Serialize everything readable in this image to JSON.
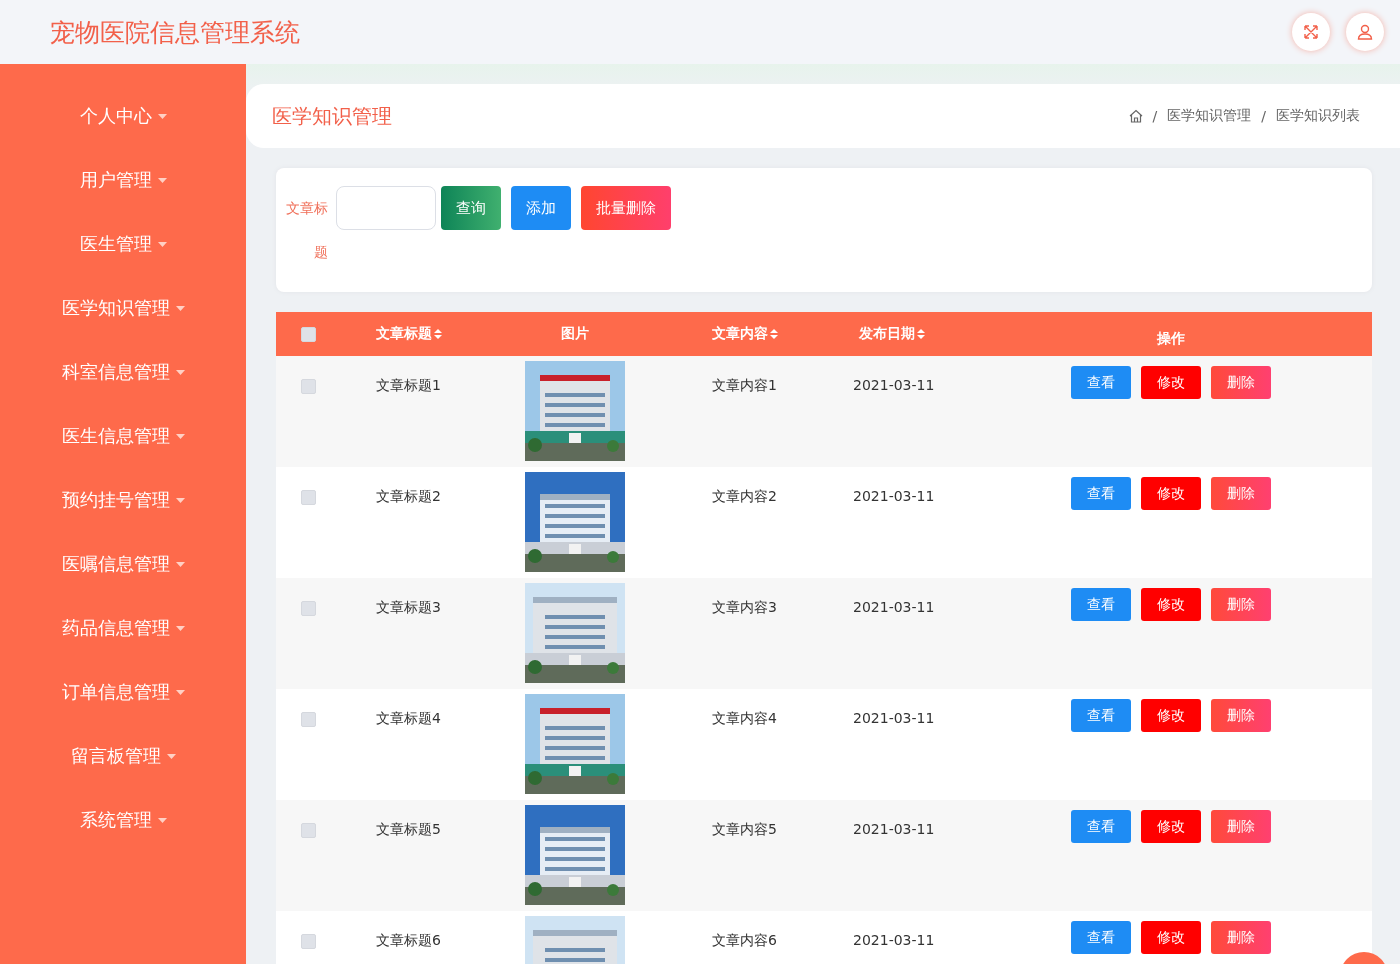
{
  "header": {
    "title": "宠物医院信息管理系统"
  },
  "sidebar": {
    "items": [
      {
        "label": "个人中心"
      },
      {
        "label": "用户管理"
      },
      {
        "label": "医生管理"
      },
      {
        "label": "医学知识管理"
      },
      {
        "label": "科室信息管理"
      },
      {
        "label": "医生信息管理"
      },
      {
        "label": "预约挂号管理"
      },
      {
        "label": "医嘱信息管理"
      },
      {
        "label": "药品信息管理"
      },
      {
        "label": "订单信息管理"
      },
      {
        "label": "留言板管理"
      },
      {
        "label": "系统管理"
      }
    ]
  },
  "page_title": "医学知识管理",
  "breadcrumb": [
    {
      "separator": "/",
      "label": "医学知识管理"
    },
    {
      "separator": "/",
      "label": "医学知识列表"
    }
  ],
  "search": {
    "label": "文章标题",
    "buttons": [
      {
        "label": "查询",
        "kind": "query"
      },
      {
        "label": "添加",
        "kind": "add"
      },
      {
        "label": "批量删除",
        "kind": "delete"
      }
    ]
  },
  "table": {
    "header_checked": false,
    "columns": [
      {
        "label": "文章标题",
        "sortable": true
      },
      {
        "label": "图片",
        "sortable": false
      },
      {
        "label": "文章内容",
        "sortable": true
      },
      {
        "label": "发布日期",
        "sortable": true
      },
      {
        "label": "操作",
        "sortable": false
      }
    ],
    "rows": [
      {
        "checked": false,
        "title": "文章标题1",
        "content": "文章内容1",
        "date": "2021-03-11",
        "actions": [
          "查看",
          "修改",
          "删除"
        ]
      },
      {
        "checked": false,
        "title": "文章标题2",
        "content": "文章内容2",
        "date": "2021-03-11",
        "actions": [
          "查看",
          "修改",
          "删除"
        ]
      },
      {
        "checked": false,
        "title": "文章标题3",
        "content": "文章内容3",
        "date": "2021-03-11",
        "actions": [
          "查看",
          "修改",
          "删除"
        ]
      },
      {
        "checked": false,
        "title": "文章标题4",
        "content": "文章内容4",
        "date": "2021-03-11",
        "actions": [
          "查看",
          "修改",
          "删除"
        ]
      },
      {
        "checked": false,
        "title": "文章标题5",
        "content": "文章内容5",
        "date": "2021-03-11",
        "actions": [
          "查看",
          "修改",
          "删除"
        ]
      },
      {
        "checked": false,
        "title": "文章标题6",
        "content": "文章内容6",
        "date": "2021-03-11",
        "actions": [
          "查看",
          "修改",
          "删除"
        ]
      }
    ]
  }
}
